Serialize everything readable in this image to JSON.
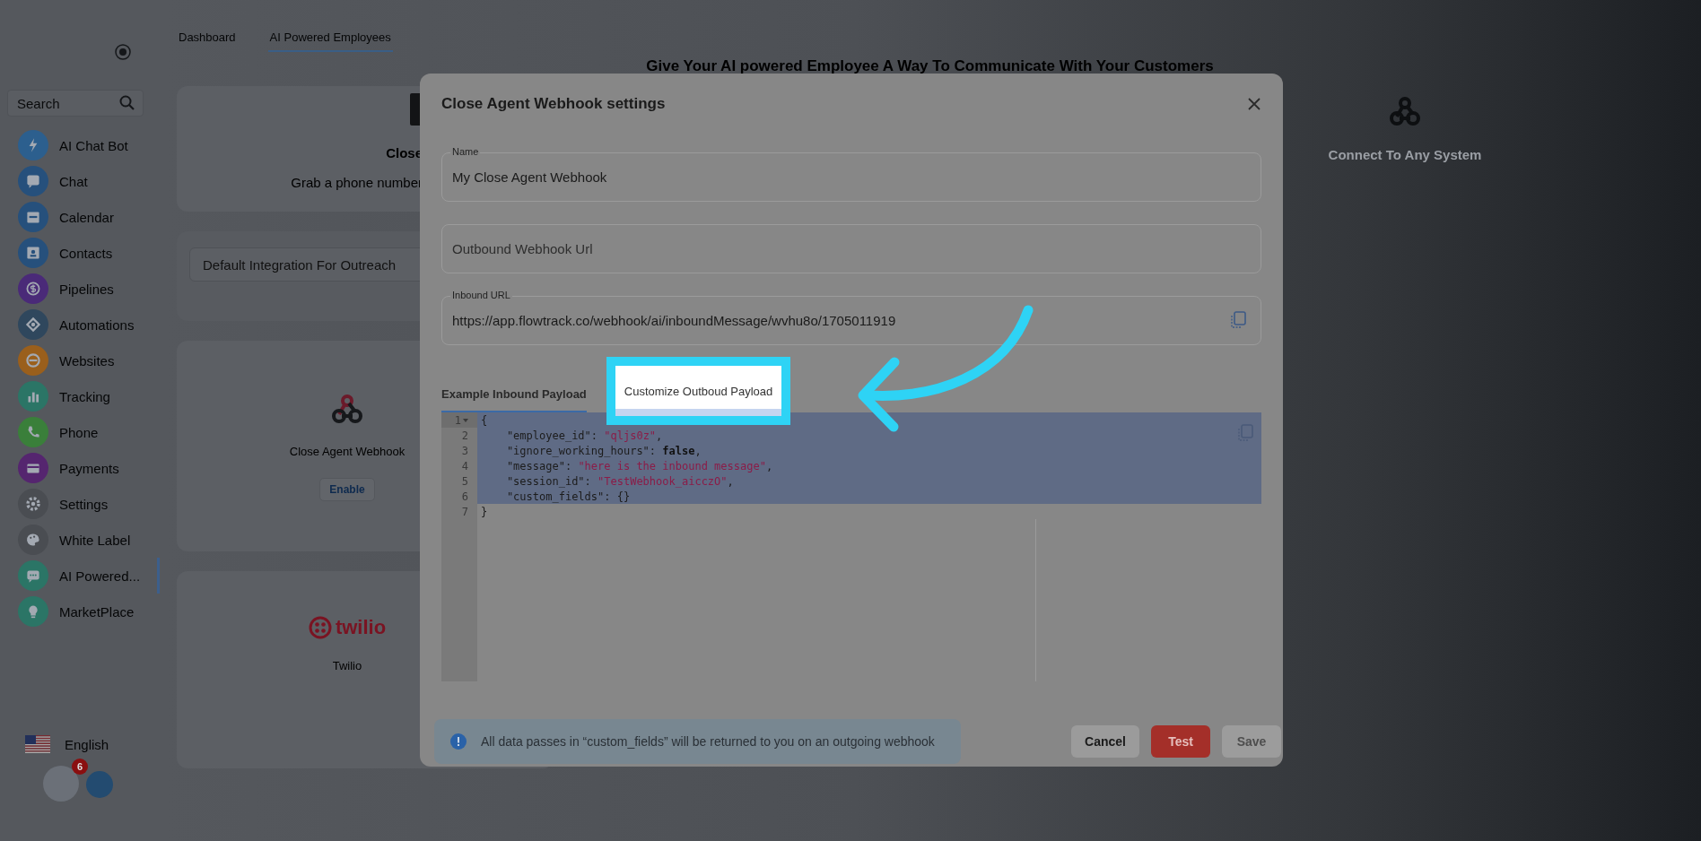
{
  "sidebar": {
    "search": {
      "placeholder": "Search"
    },
    "items": [
      {
        "label": "AI Chat Bot",
        "color": "#2c5f8e",
        "selected": false
      },
      {
        "label": "Chat",
        "color": "#26507c",
        "selected": false
      },
      {
        "label": "Calendar",
        "color": "#26507c",
        "selected": false
      },
      {
        "label": "Contacts",
        "color": "#26507c",
        "selected": false
      },
      {
        "label": "Pipelines",
        "color": "#4a2a78",
        "selected": false
      },
      {
        "label": "Automations",
        "color": "#2f475d",
        "selected": false
      },
      {
        "label": "Websites",
        "color": "#9a5f1c",
        "selected": false
      },
      {
        "label": "Tracking",
        "color": "#2b7566",
        "selected": false
      },
      {
        "label": "Phone",
        "color": "#3a7f3a",
        "selected": false
      },
      {
        "label": "Payments",
        "color": "#55256f",
        "selected": false
      },
      {
        "label": "Settings",
        "color": "#4a4d52",
        "selected": false
      },
      {
        "label": "White Label",
        "color": "#4a4d52",
        "selected": false
      },
      {
        "label": "AI Powered...",
        "color": "#2b7566",
        "selected": true
      },
      {
        "label": "MarketPlace",
        "color": "#2b7566",
        "selected": false
      }
    ],
    "language": "English",
    "notification_count": "6"
  },
  "nav_tabs": [
    {
      "label": "Dashboard",
      "selected": false
    },
    {
      "label": "AI Powered Employees",
      "selected": true
    }
  ],
  "heading": "Give Your AI powered Employee A Way To Communicate With Your Customers",
  "phone_card": {
    "title": "Close",
    "description": "Grab a phone number"
  },
  "default_integration": {
    "placeholder": "Default Integration For Outreach"
  },
  "integrations": [
    {
      "kind": "webhook",
      "name": "Close Agent Webhook",
      "button": "Enable"
    },
    {
      "kind": "twilio",
      "logo_text": "twilio",
      "name": "Twilio"
    }
  ],
  "system_card": {
    "title": "Connect To Any System"
  },
  "modal": {
    "title": "Close Agent Webhook settings",
    "fields": [
      {
        "label": "Name",
        "value": "My Close Agent Webhook",
        "copyable": false
      },
      {
        "placeholder": "Outbound Webhook Url",
        "copyable": false
      },
      {
        "label": "Inbound URL",
        "value": "https://app.flowtrack.co/webhook/ai/inboundMessage/wvhu8o/1705011919",
        "copyable": true
      }
    ],
    "tabs": [
      {
        "label": "Example Inbound Payload",
        "selected": true,
        "highlighted": false
      },
      {
        "label": "Customize Outboud Payload",
        "selected": false,
        "highlighted": true
      }
    ],
    "editor": {
      "lines": [
        {
          "number": "1",
          "selected": true,
          "foldable": true,
          "tokens": [
            {
              "kind": "punct",
              "text": "{"
            }
          ]
        },
        {
          "number": "2",
          "selected": true,
          "foldable": false,
          "tokens": [
            {
              "kind": "key",
              "text": "    \"employee_id\": "
            },
            {
              "kind": "string",
              "text": "\"qljs0z\""
            },
            {
              "kind": "punct",
              "text": ","
            }
          ]
        },
        {
          "number": "3",
          "selected": true,
          "foldable": false,
          "tokens": [
            {
              "kind": "key",
              "text": "    \"ignore_working_hours\": "
            },
            {
              "kind": "keyword",
              "text": "false"
            },
            {
              "kind": "punct",
              "text": ","
            }
          ]
        },
        {
          "number": "4",
          "selected": true,
          "foldable": false,
          "tokens": [
            {
              "kind": "key",
              "text": "    \"message\": "
            },
            {
              "kind": "string",
              "text": "\"here is the inbound message\""
            },
            {
              "kind": "punct",
              "text": ","
            }
          ]
        },
        {
          "number": "5",
          "selected": true,
          "foldable": false,
          "tokens": [
            {
              "kind": "key",
              "text": "    \"session_id\": "
            },
            {
              "kind": "string",
              "text": "\"TestWebhook_aicczO\""
            },
            {
              "kind": "punct",
              "text": ","
            }
          ]
        },
        {
          "number": "6",
          "selected": true,
          "foldable": false,
          "tokens": [
            {
              "kind": "key",
              "text": "    \"custom_fields\": {}"
            }
          ]
        },
        {
          "number": "7",
          "selected": false,
          "foldable": false,
          "tokens": [
            {
              "kind": "punct",
              "text": "}"
            }
          ]
        }
      ]
    },
    "notice": "All data passes in “custom_fields” will be returned to you on an outgoing webhook",
    "buttons": [
      {
        "kind": "secondary",
        "label": "Cancel",
        "disabled": false
      },
      {
        "kind": "danger",
        "label": "Test",
        "disabled": false
      },
      {
        "kind": "primary",
        "label": "Save",
        "disabled": true
      }
    ]
  }
}
